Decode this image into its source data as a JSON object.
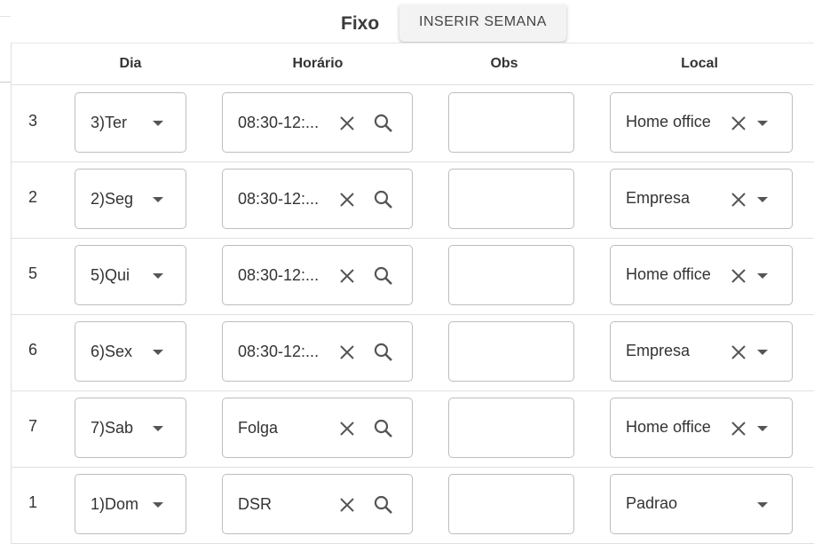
{
  "title": "Fixo",
  "insert_button": "INSERIR SEMANA",
  "headers": {
    "dia": "Dia",
    "horario": "Horário",
    "obs": "Obs",
    "local": "Local"
  },
  "rows": [
    {
      "num": "3",
      "dia": "3)Ter",
      "horario": "08:30-12:...",
      "obs": "",
      "local": "Home office",
      "local_clearable": true
    },
    {
      "num": "2",
      "dia": "2)Seg",
      "horario": "08:30-12:...",
      "obs": "",
      "local": "Empresa",
      "local_clearable": true
    },
    {
      "num": "5",
      "dia": "5)Qui",
      "horario": "08:30-12:...",
      "obs": "",
      "local": "Home office",
      "local_clearable": true
    },
    {
      "num": "6",
      "dia": "6)Sex",
      "horario": "08:30-12:...",
      "obs": "",
      "local": "Empresa",
      "local_clearable": true
    },
    {
      "num": "7",
      "dia": "7)Sab",
      "horario": "Folga",
      "obs": "",
      "local": "Home office",
      "local_clearable": true
    },
    {
      "num": "1",
      "dia": "1)Dom",
      "horario": "DSR",
      "obs": "",
      "local": "Padrao",
      "local_clearable": false
    }
  ],
  "icons": {
    "clear": "close-icon",
    "search": "search-icon",
    "dropdown": "chevron-down-icon"
  }
}
